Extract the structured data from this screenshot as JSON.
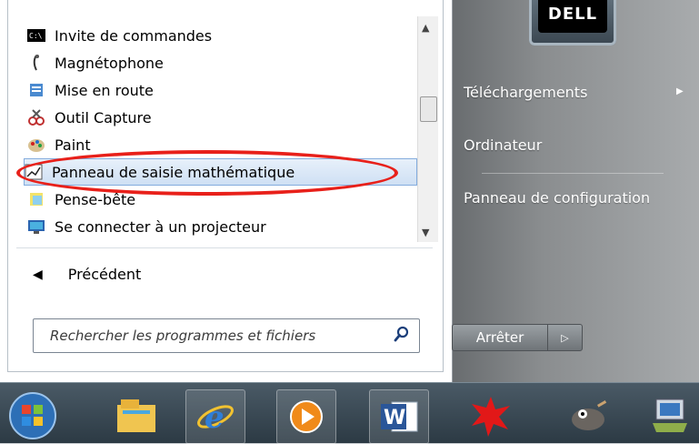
{
  "start_menu": {
    "programs": [
      {
        "label": "Invite de commandes",
        "icon": "cmd-icon"
      },
      {
        "label": "Magnétophone",
        "icon": "microphone-icon"
      },
      {
        "label": "Mise en route",
        "icon": "getting-started-icon"
      },
      {
        "label": "Outil Capture",
        "icon": "scissors-icon"
      },
      {
        "label": "Paint",
        "icon": "paint-palette-icon"
      },
      {
        "label": "Panneau de saisie mathématique",
        "icon": "math-input-icon",
        "highlighted": true
      },
      {
        "label": "Pense-bête",
        "icon": "sticky-notes-icon"
      },
      {
        "label": "Se connecter à un projecteur",
        "icon": "projector-icon"
      }
    ],
    "back_label": "Précédent",
    "search": {
      "placeholder": "Rechercher les programmes et fichiers"
    },
    "right": {
      "downloads": "Téléchargements",
      "computer": "Ordinateur",
      "control_panel": "Panneau de configuration"
    },
    "user_logo_text": "DELL",
    "shutdown_label": "Arrêter"
  },
  "taskbar": {
    "items": [
      "start-orb-icon",
      "file-explorer-icon",
      "internet-explorer-icon",
      "media-player-icon",
      "word-icon",
      "gecko-app-icon",
      "gimp-icon",
      "network-app-icon"
    ]
  },
  "colors": {
    "annotation": "#e8201a",
    "highlight": "#cfe0f4"
  }
}
